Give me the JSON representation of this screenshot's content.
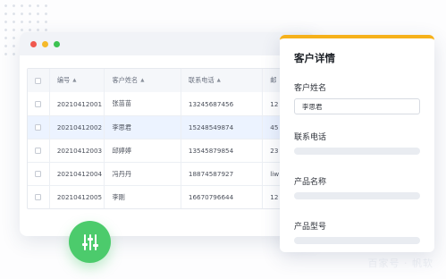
{
  "watermark": "百家号 · 帆软",
  "window": {
    "controls": [
      "close",
      "minimize",
      "maximize"
    ]
  },
  "table": {
    "headers": {
      "id": "编号",
      "name": "客户姓名",
      "phone": "联系电话",
      "extra": "邮"
    },
    "sort_icon": "sort-caret-icon",
    "rows": [
      {
        "id": "20210412001",
        "name": "张苗苗",
        "phone": "13245687456",
        "extra": "12",
        "selected": false
      },
      {
        "id": "20210412002",
        "name": "李思君",
        "phone": "15248549874",
        "extra": "45",
        "selected": true
      },
      {
        "id": "20210412003",
        "name": "邱婷婷",
        "phone": "13545879854",
        "extra": "23",
        "selected": false
      },
      {
        "id": "20210412004",
        "name": "冯丹丹",
        "phone": "18874587927",
        "extra": "liw",
        "selected": false
      },
      {
        "id": "20210412005",
        "name": "李刚",
        "phone": "16670796644",
        "extra": "12",
        "selected": false
      }
    ]
  },
  "fab": {
    "icon": "filter-sliders-icon"
  },
  "detail": {
    "title": "客户详情",
    "name_label": "客户姓名",
    "name_value": "李思君",
    "phone_label": "联系电话",
    "product_name_label": "产品名称",
    "product_model_label": "产品型号"
  },
  "colors": {
    "accent_yellow": "#f6b11b",
    "fab_green": "#4ccb6c",
    "selected_row": "#ecf3ff"
  }
}
